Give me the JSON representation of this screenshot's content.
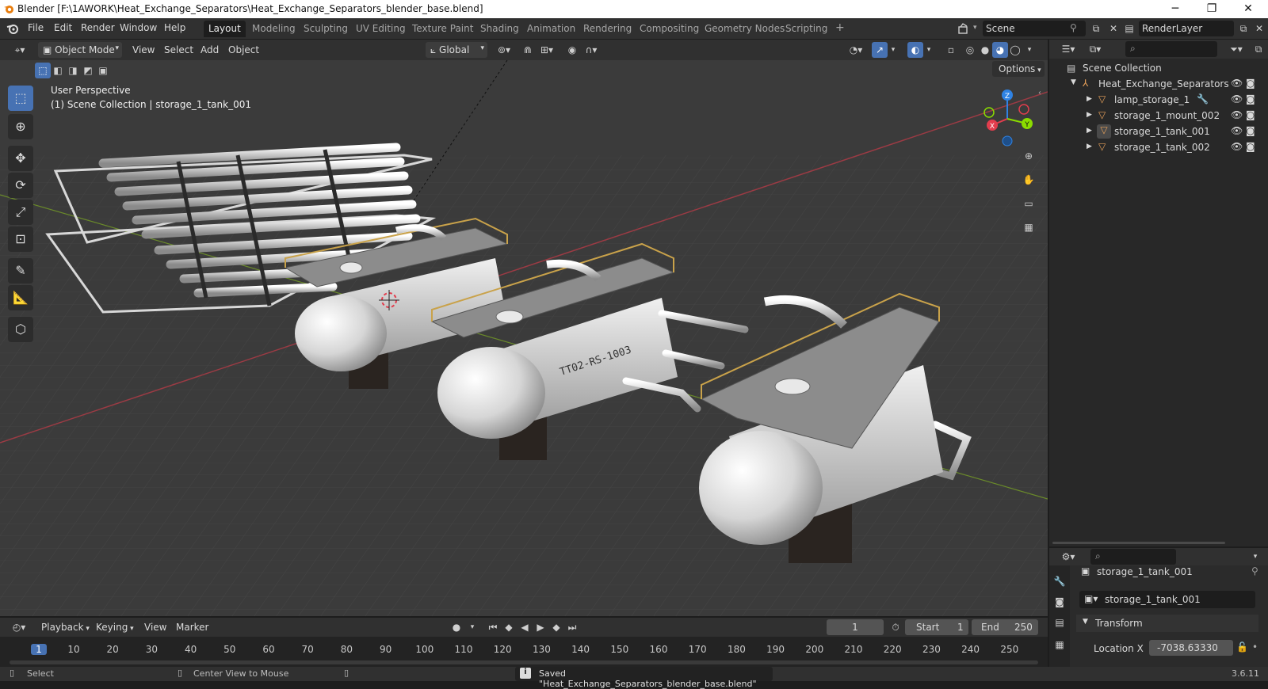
{
  "window": {
    "title": "Blender [F:\\1AWORK\\Heat_Exchange_Separators\\Heat_Exchange_Separators_blender_base.blend]",
    "minimize": "─",
    "restore": "❐",
    "close": "✕"
  },
  "menus": [
    "File",
    "Edit",
    "Render",
    "Window",
    "Help"
  ],
  "workspaces": [
    "Layout",
    "Modeling",
    "Sculpting",
    "UV Editing",
    "Texture Paint",
    "Shading",
    "Animation",
    "Rendering",
    "Compositing",
    "Geometry Nodes",
    "Scripting"
  ],
  "active_workspace": "Layout",
  "scene": {
    "name": "Scene",
    "render_layer": "RenderLayer"
  },
  "viewport_header": {
    "mode": "Object Mode",
    "menus": [
      "View",
      "Select",
      "Add",
      "Object"
    ],
    "transform_orientation": "Global",
    "options": "Options"
  },
  "viewport": {
    "perspective": "User Perspective",
    "collection_info": "(1) Scene Collection | storage_1_tank_001",
    "tank_label": "TT02-RS-1003"
  },
  "gizmo": {
    "x": "X",
    "y": "Y",
    "z": "Z"
  },
  "outliner": {
    "root": "Scene Collection",
    "collection": "Heat_Exchange_Separators",
    "items": [
      "lamp_storage_1",
      "storage_1_mount_002",
      "storage_1_tank_001",
      "storage_1_tank_002"
    ],
    "selected": "storage_1_tank_001"
  },
  "properties": {
    "object_name": "storage_1_tank_001",
    "data_name": "storage_1_tank_001",
    "section": "Transform",
    "location_label": "Location X",
    "location_x": "-7038.63330"
  },
  "timeline": {
    "menus": [
      "Playback",
      "Keying",
      "View",
      "Marker"
    ],
    "current_frame": "1",
    "start_label": "Start",
    "start": "1",
    "end_label": "End",
    "end": "250",
    "ticks": [
      "1",
      "10",
      "20",
      "30",
      "40",
      "50",
      "60",
      "70",
      "80",
      "90",
      "100",
      "110",
      "120",
      "130",
      "140",
      "150",
      "160",
      "170",
      "180",
      "190",
      "200",
      "210",
      "220",
      "230",
      "240",
      "250"
    ]
  },
  "statusbar": {
    "select": "Select",
    "center": "Center View to Mouse",
    "message": "Saved \"Heat_Exchange_Separators_blender_base.blend\"",
    "version": "3.6.11"
  },
  "colors": {
    "accent": "#4772b3",
    "header": "#303030",
    "viewport_bg": "#3b3b3b",
    "axis_x": "#e23d4d",
    "axis_y": "#8bdc00",
    "axis_z": "#2f83e4"
  }
}
